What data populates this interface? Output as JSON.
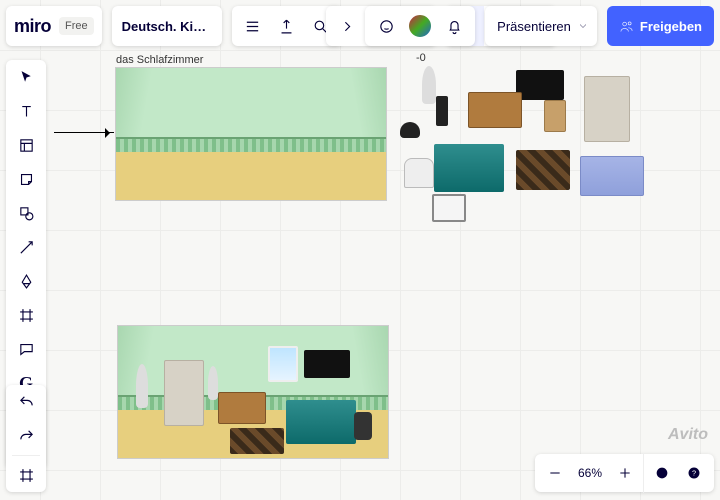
{
  "brand": {
    "name": "miro",
    "plan": "Free"
  },
  "board": {
    "name": "Deutsch. Kinder"
  },
  "present": {
    "label": "Präsentieren"
  },
  "share": {
    "label": "Freigeben"
  },
  "frame1": {
    "label": "das Schlafzimmer"
  },
  "ruler": {
    "mark": "-0"
  },
  "zoom": {
    "level": "66%"
  },
  "watermark": "Avito",
  "icons": {
    "cursor": "cursor",
    "text": "T",
    "template": "template",
    "sticky": "sticky",
    "shape": "shape",
    "line": "line",
    "pen": "pen",
    "frame": "frame",
    "comment": "comment",
    "google": "G",
    "image": "image",
    "more": "plus",
    "undo": "undo",
    "redo": "redo",
    "fit": "fit"
  }
}
